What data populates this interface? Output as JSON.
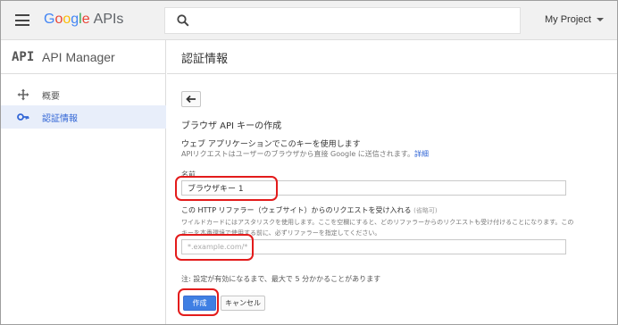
{
  "topbar": {
    "logo_letters": [
      "G",
      "o",
      "o",
      "g",
      "l",
      "e"
    ],
    "logo_suffix": "APIs",
    "search": {
      "value": "",
      "placeholder": ""
    },
    "project": "My Project"
  },
  "sidebar": {
    "logo": "API",
    "title": "API Manager",
    "items": [
      {
        "label": "概要",
        "icon": "move-arrows-icon",
        "active": false
      },
      {
        "label": "認証情報",
        "icon": "key-icon",
        "active": true
      }
    ]
  },
  "main": {
    "page_title": "認証情報",
    "form_title": "ブラウザ API キーの作成",
    "section_title": "ウェブ アプリケーションでこのキーを使用します",
    "section_desc": "APIリクエストはユーザーのブラウザから直接 Google に送信されます。",
    "section_link": "詳細",
    "name_label": "名前",
    "name_value": "ブラウザキー 1",
    "referrer_label": "この HTTP リファラー（ウェブサイト）からのリクエストを受け入れる",
    "referrer_optional": "(省略可)",
    "referrer_help": "ワイルドカードにはアスタリスクを使用します。ここを空欄にすると、どのリファラーからのリクエストも受け付けることになります。このキーを本番環境で使用する前に、必ずリファラーを指定してください。",
    "referrer_placeholder": "*.example.com/*",
    "referrer_value": "",
    "note": "注: 設定が有効になるまで、最大で 5 分かかることがあります",
    "create_label": "作成",
    "cancel_label": "キャンセル"
  },
  "colors": {
    "accent": "#3f7fe3",
    "highlight": "#e31b1b",
    "active_bg": "#e8eefa"
  }
}
